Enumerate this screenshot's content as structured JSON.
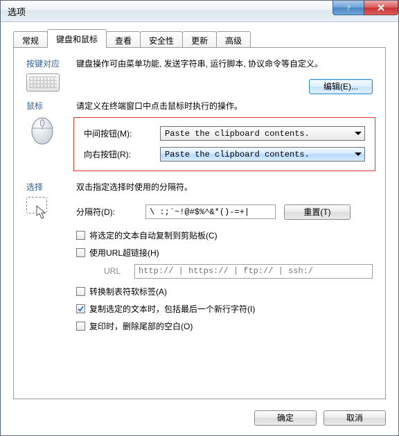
{
  "window": {
    "title": "选项"
  },
  "tabs": [
    "常规",
    "键盘和鼠标",
    "查看",
    "安全性",
    "更新",
    "高级"
  ],
  "active_tab_index": 1,
  "sections": {
    "keys": {
      "title": "按键对应",
      "desc": "键盘操作可由菜单功能, 发送字符串, 运行脚本, 协议命令等自定义。",
      "edit_btn": "编辑(E)..."
    },
    "mouse": {
      "title": "鼠标",
      "desc": "请定义在终端窗口中点击鼠标时执行的操作。",
      "middle_label": "中间按钮(M):",
      "right_label": "向右按钮(R):",
      "middle_value": "Paste the clipboard contents.",
      "right_value": "Paste the clipboard contents."
    },
    "selection": {
      "title": "选择",
      "desc": "双击指定选择时使用的分隔符。",
      "delim_label": "分隔符(D):",
      "delim_value": "\\ :;`~!@#$%^&*()-=+|",
      "reset_btn": "重置(T)",
      "cb_autocopy": "将选定的文本自动复制到剪贴板(C)",
      "cb_url": "使用URL超链接(H)",
      "url_label": "URL",
      "url_placeholder": "http:// | https:// | ftp:// | ssh:/",
      "cb_softtab": "转换制表符软标签(A)",
      "cb_copynl": "复制选定的文本时，包括最后一个新行字符(I)",
      "cb_trimws": "复印时，删除尾部的空白(O)"
    }
  },
  "footer": {
    "ok": "确定",
    "cancel": "取消"
  }
}
